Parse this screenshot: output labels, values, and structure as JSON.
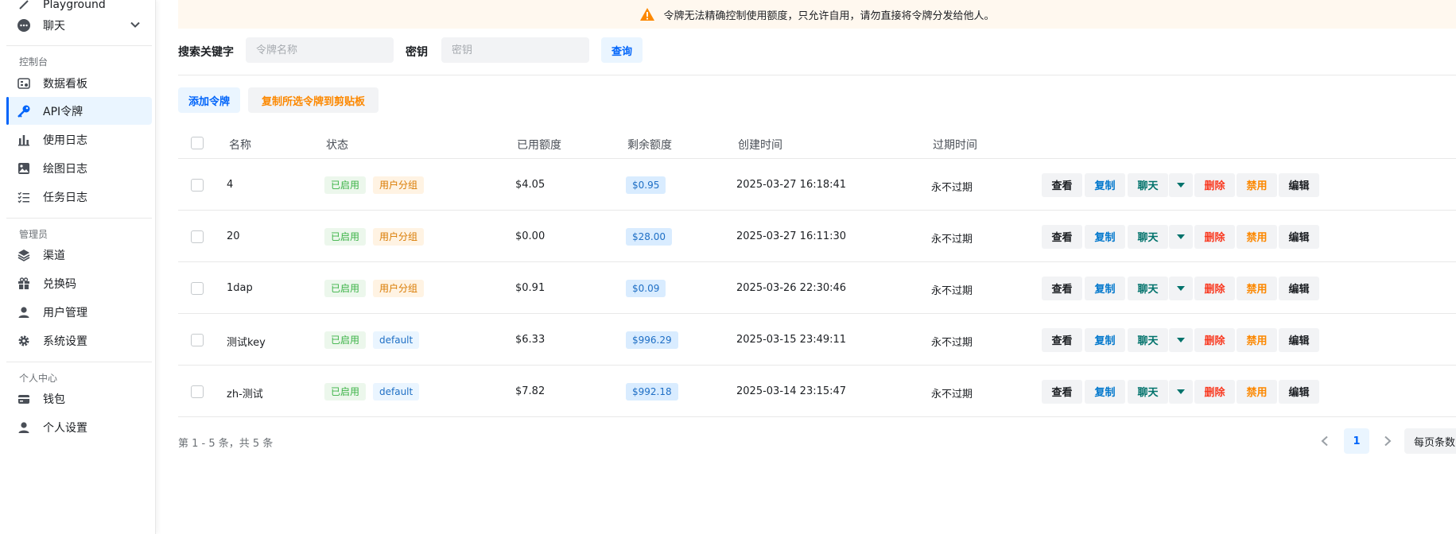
{
  "sidebar": {
    "top_partial": "Playground",
    "chat": "聊天",
    "groups": {
      "console": "控制台",
      "admin": "管理员",
      "personal": "个人中心"
    },
    "items": [
      {
        "label": "数据看板",
        "icon": "dashboard-icon"
      },
      {
        "label": "API令牌",
        "icon": "key-icon",
        "active": true
      },
      {
        "label": "使用日志",
        "icon": "bar-chart-icon"
      },
      {
        "label": "绘图日志",
        "icon": "image-icon"
      },
      {
        "label": "任务日志",
        "icon": "task-list-icon"
      },
      {
        "label": "渠道",
        "icon": "layers-icon"
      },
      {
        "label": "兑换码",
        "icon": "gift-icon"
      },
      {
        "label": "用户管理",
        "icon": "user-icon"
      },
      {
        "label": "系统设置",
        "icon": "gear-icon"
      },
      {
        "label": "钱包",
        "icon": "wallet-icon"
      },
      {
        "label": "个人设置",
        "icon": "user-icon"
      }
    ]
  },
  "banner": {
    "text": "令牌无法精确控制使用额度，只允许自用，请勿直接将令牌分发给他人。",
    "icon": "warning-icon",
    "color": "#fc8800"
  },
  "search": {
    "keyword_label": "搜索关键字",
    "keyword_placeholder": "令牌名称",
    "key_label": "密钥",
    "key_placeholder": "密钥",
    "query_button": "查询"
  },
  "toolbar": {
    "add_button": "添加令牌",
    "copy_selected_button": "复制所选令牌到剪贴板"
  },
  "table": {
    "headers": {
      "name": "名称",
      "status": "状态",
      "used": "已用额度",
      "remaining": "剩余额度",
      "created": "创建时间",
      "expires": "过期时间"
    },
    "actions": {
      "view": "查看",
      "copy": "复制",
      "chat": "聊天",
      "delete": "删除",
      "disable": "禁用",
      "edit": "编辑"
    },
    "rows": [
      {
        "name": "4",
        "status": "已启用",
        "group": "用户分组",
        "used": "$4.05",
        "remaining": "$0.95",
        "created": "2025-03-27 16:18:41",
        "expires": "永不过期"
      },
      {
        "name": "20",
        "status": "已启用",
        "group": "用户分组",
        "used": "$0.00",
        "remaining": "$28.00",
        "created": "2025-03-27 16:11:30",
        "expires": "永不过期"
      },
      {
        "name": "1dap",
        "status": "已启用",
        "group": "用户分组",
        "used": "$0.91",
        "remaining": "$0.09",
        "created": "2025-03-26 22:30:46",
        "expires": "永不过期"
      },
      {
        "name": "测试key",
        "status": "已启用",
        "group": "default",
        "used": "$6.33",
        "remaining": "$996.29",
        "created": "2025-03-15 23:49:11",
        "expires": "永不过期"
      },
      {
        "name": "zh-测试",
        "status": "已启用",
        "group": "default",
        "used": "$7.82",
        "remaining": "$992.18",
        "created": "2025-03-14 23:15:47",
        "expires": "永不过期"
      }
    ]
  },
  "pagination": {
    "info": "第 1 - 5 条，共 5 条",
    "current_page": "1",
    "page_size_label": "每页条数"
  }
}
